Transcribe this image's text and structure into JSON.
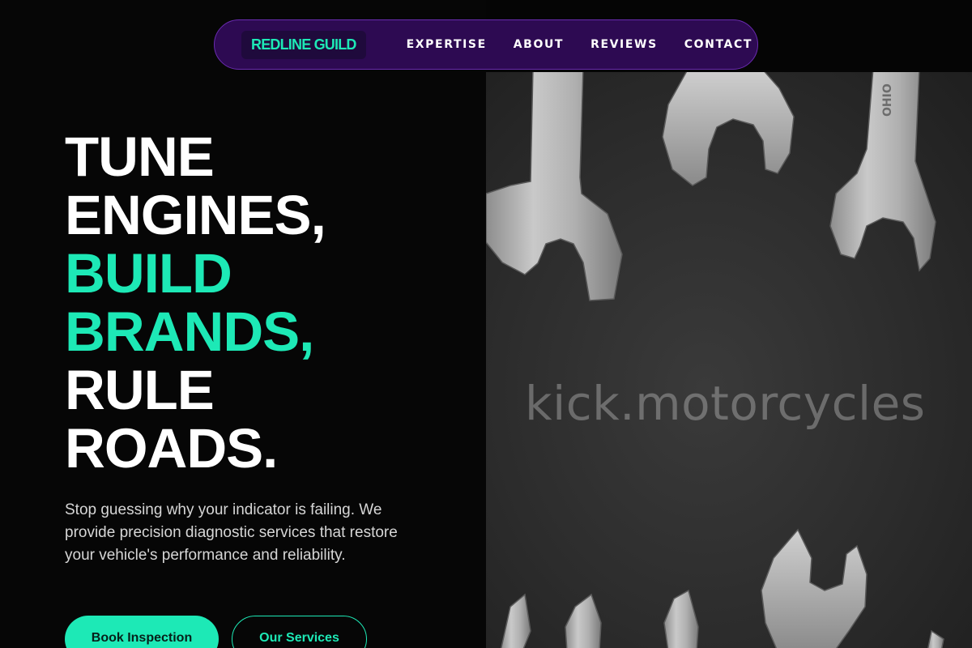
{
  "nav": {
    "brand": "REDLINE GUILD",
    "links": [
      "EXPERTISE",
      "ABOUT",
      "REVIEWS",
      "CONTACT"
    ]
  },
  "hero": {
    "headline": [
      "TUNE",
      "ENGINES,",
      "BUILD",
      "BRANDS,",
      "RULE",
      "ROADS."
    ],
    "subcopy": "Stop guessing why your indicator is failing. We provide precision diagnostic services that restore your vehicle's performance and reliability.",
    "primary_cta": "Book Inspection",
    "secondary_cta": "Our Services"
  },
  "image": {
    "subject": "wrenches-on-dark-fabric",
    "watermark": "kick.motorcycles"
  },
  "colors": {
    "accent": "#1de9b6",
    "nav_bg": "#2d0a52",
    "page_bg": "#060606"
  }
}
